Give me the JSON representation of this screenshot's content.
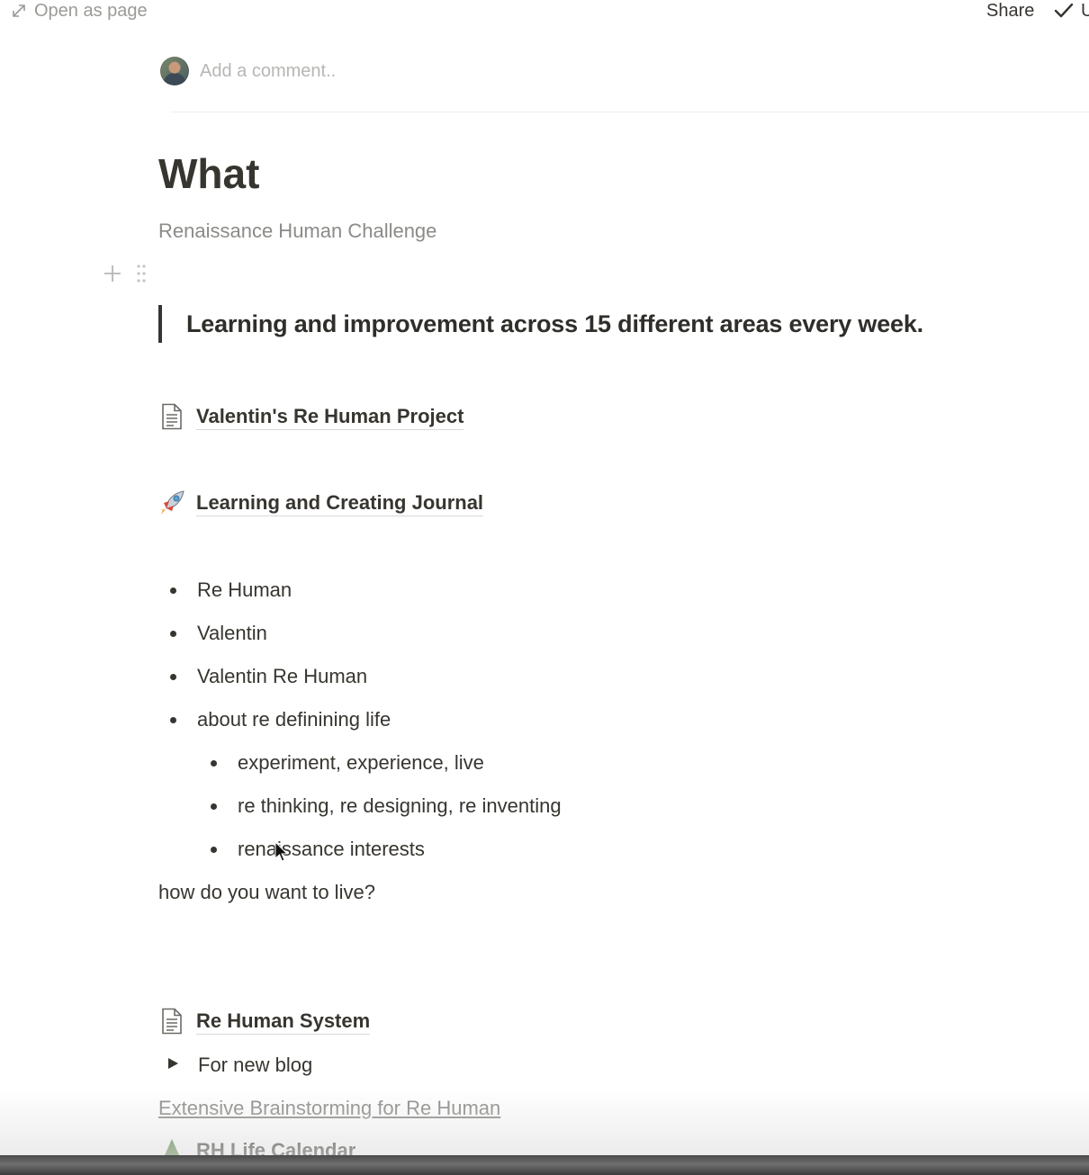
{
  "topbar": {
    "open_as_page": "Open as page",
    "share": "Share",
    "right_cut_label": "U"
  },
  "comment": {
    "placeholder": "Add a comment.."
  },
  "page": {
    "title": "What",
    "subtitle": "Renaissance Human Challenge",
    "quote": "Learning and improvement across 15 different areas every week."
  },
  "links": {
    "project": {
      "label": "Valentin's Re Human Project",
      "icon": "page-document-icon"
    },
    "journal": {
      "label": "Learning and Creating Journal",
      "icon": "rocket-icon"
    },
    "system": {
      "label": "Re Human System",
      "icon": "page-document-icon"
    },
    "calendar": {
      "label": "RH Life Calendar",
      "icon": "tree-icon"
    }
  },
  "bullets": [
    "Re Human",
    "Valentin",
    "Valentin Re Human",
    "about re definining life"
  ],
  "sub_bullets": [
    "experiment, experience, live",
    "re thinking, re designing, re inventing",
    "renaissance interests"
  ],
  "question": "how do you want to live?",
  "toggle": {
    "label": "For new blog"
  },
  "plain_link": "Extensive Brainstorming for Re Human",
  "colors": {
    "text": "#37352f",
    "muted": "#8c8b88",
    "placeholder": "#b7b6b3"
  }
}
